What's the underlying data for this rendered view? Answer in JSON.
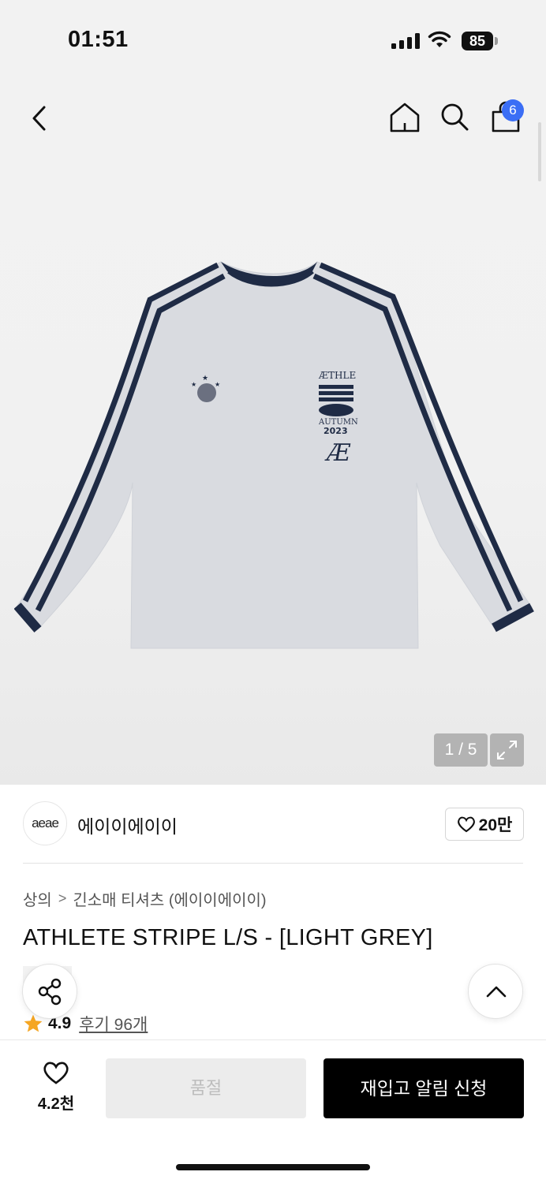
{
  "status": {
    "time": "01:51",
    "battery": "85"
  },
  "nav": {
    "cart_count": "6"
  },
  "gallery": {
    "pager": "1 / 5",
    "print_lines": [
      "ÆTHLE",
      "AUTUMN",
      "2023"
    ]
  },
  "brand": {
    "logo_text": "aeae",
    "name": "에이이에이이",
    "likes": "20만"
  },
  "product": {
    "breadcrumb": [
      "상의",
      "긴소매 티셔츠 (에이이에이이)"
    ],
    "breadcrumb_sep": ">",
    "title": "ATHLETE STRIPE L/S - [LIGHT GREY]",
    "rating": "4.9",
    "reviews": "후기 96개"
  },
  "actions": {
    "wish_count": "4.2천",
    "soldout": "품절",
    "restock": "재입고 알림 신청"
  },
  "colors": {
    "accent_blue": "#3b6ef5",
    "star": "#f5a623",
    "navy": "#1f2b45",
    "shirt_grey": "#d9dbe0"
  }
}
